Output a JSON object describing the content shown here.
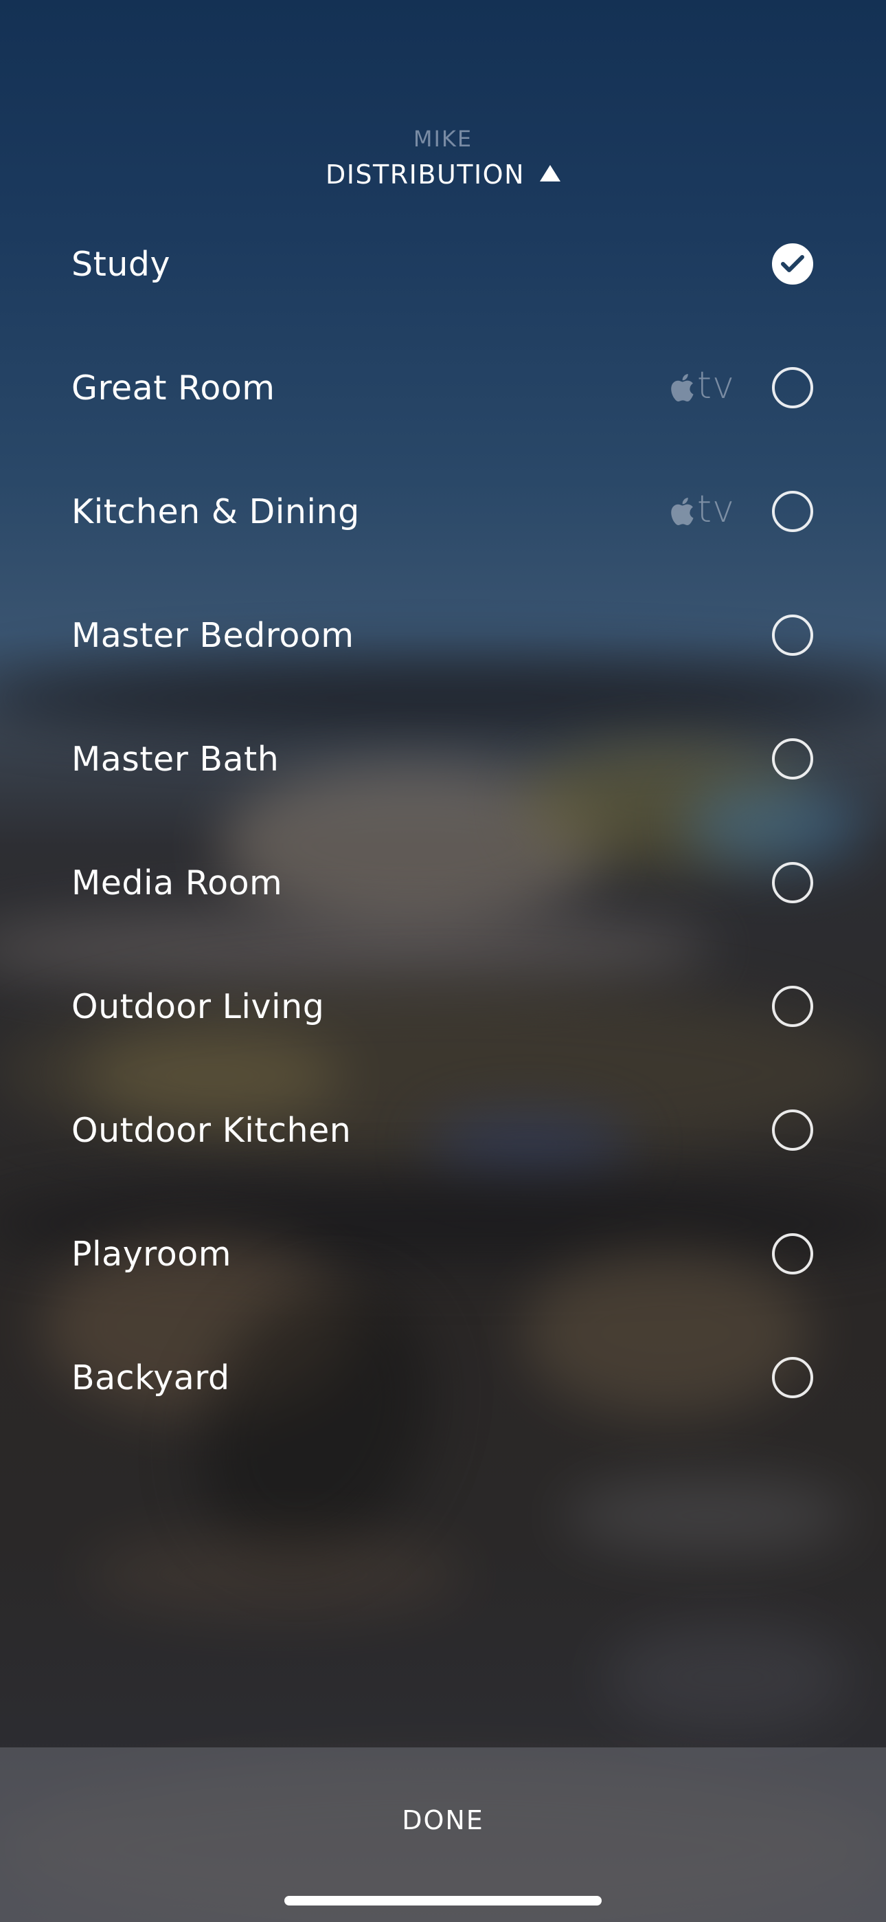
{
  "header": {
    "user": "MIKE",
    "zone": "DISTRIBUTION"
  },
  "rooms": [
    {
      "label": "Study",
      "apple_tv": false,
      "selected": true
    },
    {
      "label": "Great Room",
      "apple_tv": true,
      "selected": false
    },
    {
      "label": "Kitchen & Dining",
      "apple_tv": true,
      "selected": false
    },
    {
      "label": "Master Bedroom",
      "apple_tv": false,
      "selected": false
    },
    {
      "label": "Master Bath",
      "apple_tv": false,
      "selected": false
    },
    {
      "label": "Media Room",
      "apple_tv": false,
      "selected": false
    },
    {
      "label": "Outdoor Living",
      "apple_tv": false,
      "selected": false
    },
    {
      "label": "Outdoor Kitchen",
      "apple_tv": false,
      "selected": false
    },
    {
      "label": "Playroom",
      "apple_tv": false,
      "selected": false
    },
    {
      "label": "Backyard",
      "apple_tv": false,
      "selected": false
    }
  ],
  "apple_tv_badge": {
    "text": "tv",
    "icon": "apple-icon"
  },
  "footer": {
    "done_label": "DONE"
  },
  "icons": {
    "selected": "checkmark-icon",
    "unselected": "empty-circle-icon",
    "expand": "triangle-up-icon"
  }
}
